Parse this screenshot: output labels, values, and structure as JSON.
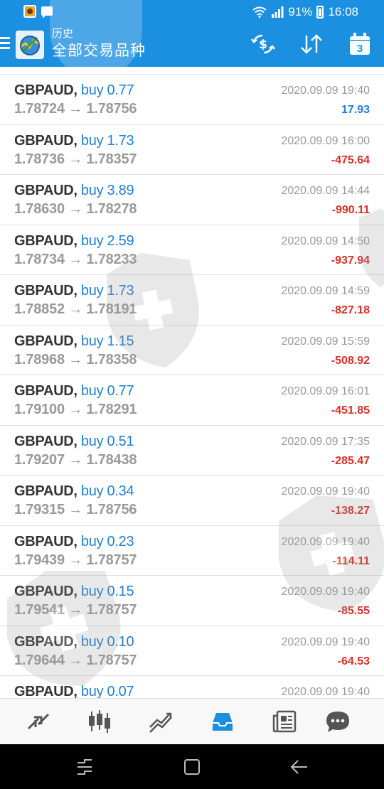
{
  "status_bar": {
    "battery": "91%",
    "time": "16:08"
  },
  "app_bar": {
    "title": "历史",
    "subtitle": "全部交易品种",
    "calendar_day": "3"
  },
  "trades": [
    {
      "symbol": "GBPAUD,",
      "side": "buy",
      "volume": "0.77",
      "open": "1.78724",
      "close": "1.78756",
      "time": "2020.09.09 19:40",
      "profit": "17.93"
    },
    {
      "symbol": "GBPAUD,",
      "side": "buy",
      "volume": "1.73",
      "open": "1.78736",
      "close": "1.78357",
      "time": "2020.09.09 16:00",
      "profit": "-475.64"
    },
    {
      "symbol": "GBPAUD,",
      "side": "buy",
      "volume": "3.89",
      "open": "1.78630",
      "close": "1.78278",
      "time": "2020.09.09 14:44",
      "profit": "-990.11"
    },
    {
      "symbol": "GBPAUD,",
      "side": "buy",
      "volume": "2.59",
      "open": "1.78734",
      "close": "1.78233",
      "time": "2020.09.09 14:50",
      "profit": "-937.94"
    },
    {
      "symbol": "GBPAUD,",
      "side": "buy",
      "volume": "1.73",
      "open": "1.78852",
      "close": "1.78191",
      "time": "2020.09.09 14:59",
      "profit": "-827.18"
    },
    {
      "symbol": "GBPAUD,",
      "side": "buy",
      "volume": "1.15",
      "open": "1.78968",
      "close": "1.78358",
      "time": "2020.09.09 15:59",
      "profit": "-508.92"
    },
    {
      "symbol": "GBPAUD,",
      "side": "buy",
      "volume": "0.77",
      "open": "1.79100",
      "close": "1.78291",
      "time": "2020.09.09 16:01",
      "profit": "-451.85"
    },
    {
      "symbol": "GBPAUD,",
      "side": "buy",
      "volume": "0.51",
      "open": "1.79207",
      "close": "1.78438",
      "time": "2020.09.09 17:35",
      "profit": "-285.47"
    },
    {
      "symbol": "GBPAUD,",
      "side": "buy",
      "volume": "0.34",
      "open": "1.79315",
      "close": "1.78756",
      "time": "2020.09.09 19:40",
      "profit": "-138.27"
    },
    {
      "symbol": "GBPAUD,",
      "side": "buy",
      "volume": "0.23",
      "open": "1.79439",
      "close": "1.78757",
      "time": "2020.09.09 19:40",
      "profit": "-114.11"
    },
    {
      "symbol": "GBPAUD,",
      "side": "buy",
      "volume": "0.15",
      "open": "1.79541",
      "close": "1.78757",
      "time": "2020.09.09 19:40",
      "profit": "-85.55"
    },
    {
      "symbol": "GBPAUD,",
      "side": "buy",
      "volume": "0.10",
      "open": "1.79644",
      "close": "1.78757",
      "time": "2020.09.09 19:40",
      "profit": "-64.53"
    },
    {
      "symbol": "GBPAUD,",
      "side": "buy",
      "volume": "0.07",
      "open": "",
      "close": "",
      "time": "2020.09.09 19:40",
      "profit": ""
    }
  ],
  "icons": {
    "menu": "menu-icon",
    "logo": "metatrader-logo-icon",
    "currency": "currency-exchange-icon",
    "sort": "sort-icon",
    "calendar": "calendar-icon",
    "nav": [
      "quotes-icon",
      "chart-icon",
      "trade-icon",
      "history-icon",
      "news-icon",
      "chat-icon"
    ]
  },
  "colors": {
    "accent": "#1b8fe0",
    "buy": "#1e7fd6",
    "profit_positive": "#1e7fd6",
    "profit_negative": "#d93025",
    "active_nav": "#1b8fe0"
  }
}
